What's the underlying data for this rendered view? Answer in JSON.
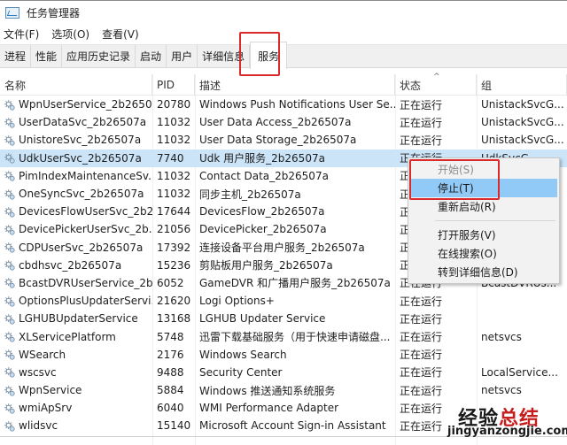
{
  "window": {
    "title": "任务管理器",
    "icon": "task-manager-icon"
  },
  "menubar": {
    "items": [
      "文件(F)",
      "选项(O)",
      "查看(V)"
    ]
  },
  "tabs": [
    {
      "label": "进程",
      "active": false
    },
    {
      "label": "性能",
      "active": false
    },
    {
      "label": "应用历史记录",
      "active": false
    },
    {
      "label": "启动",
      "active": false
    },
    {
      "label": "用户",
      "active": false
    },
    {
      "label": "详细信息",
      "active": false
    },
    {
      "label": "服务",
      "active": true
    }
  ],
  "columns": {
    "name": "名称",
    "pid": "PID",
    "desc": "描述",
    "status": "状态",
    "group": "组",
    "sorted_by": "状态"
  },
  "rows": [
    {
      "name": "WpnUserService_2b2650...",
      "pid": "20780",
      "desc": "Windows Push Notifications User Se...",
      "status": "正在运行",
      "group": "UnistackSvcG...",
      "icon": "service-gear-icon"
    },
    {
      "name": "UserDataSvc_2b26507a",
      "pid": "11032",
      "desc": "User Data Access_2b26507a",
      "status": "正在运行",
      "group": "UnistackSvcG...",
      "icon": "service-gear-icon"
    },
    {
      "name": "UnistoreSvc_2b26507a",
      "pid": "11032",
      "desc": "User Data Storage_2b26507a",
      "status": "正在运行",
      "group": "UnistackSvcG...",
      "icon": "service-gear-icon"
    },
    {
      "name": "UdkUserSvc_2b26507a",
      "pid": "7740",
      "desc": "Udk 用户服务_2b26507a",
      "status": "正在运行",
      "group": "UdkSvcG...",
      "icon": "service-gear-icon",
      "selected": true
    },
    {
      "name": "PimIndexMaintenanceSv...",
      "pid": "11032",
      "desc": "Contact Data_2b26507a",
      "status": "正在运行",
      "group": "",
      "icon": "service-gear-icon"
    },
    {
      "name": "OneSyncSvc_2b26507a",
      "pid": "11032",
      "desc": "同步主机_2b26507a",
      "status": "正在运行",
      "group": "",
      "icon": "service-gear-icon"
    },
    {
      "name": "DevicesFlowUserSvc_2b2...",
      "pid": "17644",
      "desc": "DevicesFlow_2b26507a",
      "status": "正在运行",
      "group": "",
      "icon": "service-gear-icon"
    },
    {
      "name": "DevicePickerUserSvc_2b...",
      "pid": "21056",
      "desc": "DevicePicker_2b26507a",
      "status": "正在运行",
      "group": "",
      "icon": "service-gear-icon"
    },
    {
      "name": "CDPUserSvc_2b26507a",
      "pid": "17392",
      "desc": "连接设备平台用户服务_2b26507a",
      "status": "正在运行",
      "group": "",
      "icon": "service-gear-icon"
    },
    {
      "name": "cbdhsvc_2b26507a",
      "pid": "15236",
      "desc": "剪贴板用户服务_2b26507a",
      "status": "正在运行",
      "group": "",
      "icon": "service-gear-icon"
    },
    {
      "name": "BcastDVRUserService_2b...",
      "pid": "6052",
      "desc": "GameDVR 和广播用户服务_2b26507a",
      "status": "正在运行",
      "group": "BcastDVRUs...",
      "icon": "service-gear-icon"
    },
    {
      "name": "OptionsPlusUpdaterServi...",
      "pid": "21620",
      "desc": "Logi Options+",
      "status": "正在运行",
      "group": "",
      "icon": "service-gear-icon"
    },
    {
      "name": "LGHUBUpdaterService",
      "pid": "13168",
      "desc": "LGHUB Updater Service",
      "status": "正在运行",
      "group": "",
      "icon": "service-gear-icon"
    },
    {
      "name": "XLServicePlatform",
      "pid": "5748",
      "desc": "迅雷下载基础服务（用于快速申请磁盘...",
      "status": "正在运行",
      "group": "netsvcs",
      "icon": "service-gear-icon"
    },
    {
      "name": "WSearch",
      "pid": "2176",
      "desc": "Windows Search",
      "status": "正在运行",
      "group": "",
      "icon": "service-gear-icon"
    },
    {
      "name": "wscsvc",
      "pid": "9488",
      "desc": "Security Center",
      "status": "正在运行",
      "group": "LocalService...",
      "icon": "service-gear-icon"
    },
    {
      "name": "WpnService",
      "pid": "5884",
      "desc": "Windows 推送通知系统服务",
      "status": "正在运行",
      "group": "netsvcs",
      "icon": "service-gear-icon"
    },
    {
      "name": "wmiApSrv",
      "pid": "6040",
      "desc": "WMI Performance Adapter",
      "status": "正在运行",
      "group": "",
      "icon": "service-gear-icon"
    },
    {
      "name": "wlidsvc",
      "pid": "15140",
      "desc": "Microsoft Account Sign-in Assistant",
      "status": "正在运行",
      "group": "",
      "icon": "service-gear-icon"
    }
  ],
  "context_menu": {
    "items": [
      {
        "label": "开始(S)",
        "disabled": true
      },
      {
        "label": "停止(T)",
        "highlighted": true
      },
      {
        "label": "重新启动(R)"
      },
      {
        "separator": true
      },
      {
        "label": "打开服务(V)"
      },
      {
        "label": "在线搜索(O)"
      },
      {
        "label": "转到详细信息(D)"
      }
    ]
  },
  "annotations": {
    "highlight_color": "#d92b2b"
  },
  "watermark": {
    "cn_black": "经验",
    "cn_red": "总结",
    "url": "jingyanzongjie.com"
  },
  "colors": {
    "selected_row": "#cce4f7",
    "menu_hover": "#91c9f7",
    "tab_bar": "#f0f0f0"
  }
}
